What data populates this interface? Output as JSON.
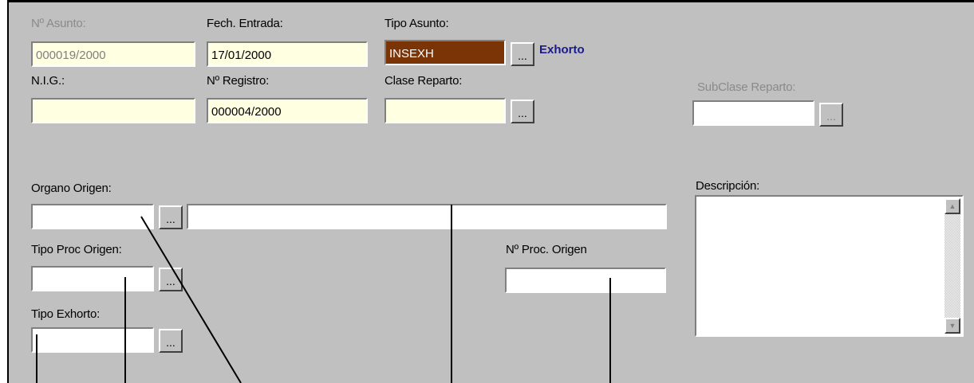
{
  "labels": {
    "num_asunto": "Nº Asunto:",
    "fech_entrada": "Fech. Entrada:",
    "tipo_asunto": "Tipo Asunto:",
    "nig": "N.I.G.:",
    "num_registro": "Nº Registro:",
    "clase_reparto": "Clase Reparto:",
    "subclase_reparto": "SubClase Reparto:",
    "organo_origen": "Organo Origen:",
    "descripcion": "Descripción:",
    "tipo_proc_origen": "Tipo Proc Origen:",
    "num_proc_origen": "Nº Proc. Origen",
    "tipo_exhorto": "Tipo Exhorto:"
  },
  "values": {
    "num_asunto": "000019/2000",
    "fech_entrada": "17/01/2000",
    "tipo_asunto": "INSEXH",
    "tipo_asunto_desc": "Exhorto",
    "nig": "",
    "num_registro": "000004/2000",
    "clase_reparto": "",
    "subclase_reparto": "",
    "organo_origen_code": "",
    "organo_origen_name": "",
    "tipo_proc_origen": "",
    "num_proc_origen": "",
    "tipo_exhorto": "",
    "descripcion": ""
  },
  "lookup_button_label": "...",
  "scroll": {
    "up_icon": "▲",
    "down_icon": "▼"
  },
  "colors": {
    "panel": "#c0c0c0",
    "field_yellow": "#ffffe1",
    "tipo_asunto_bg": "#7b3406",
    "exhorto_text": "#1a1a8c"
  }
}
